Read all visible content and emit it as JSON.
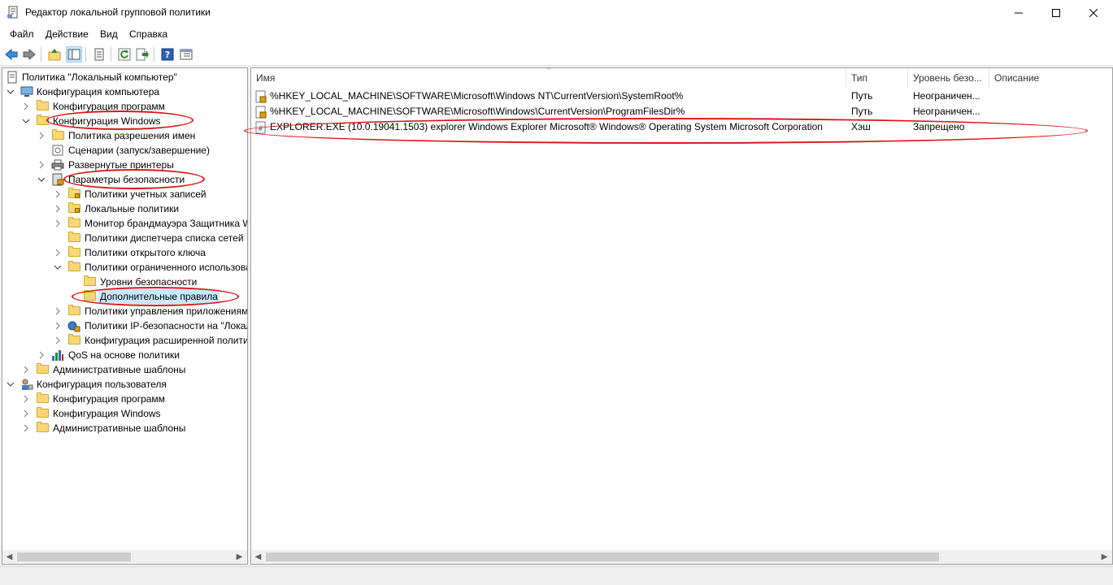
{
  "window": {
    "title": "Редактор локальной групповой политики",
    "icon": "policy-editor-icon",
    "buttons": {
      "minimize": "minimize-icon",
      "maximize": "maximize-icon",
      "close": "close-icon"
    }
  },
  "menu": [
    "Файл",
    "Действие",
    "Вид",
    "Справка"
  ],
  "toolbar": [
    "back-icon",
    "forward-icon",
    "up-folder-icon",
    "show-hide-tree-icon",
    "properties-icon",
    "refresh-icon",
    "export-list-icon",
    "help-icon",
    "extended-view-icon"
  ],
  "tree": [
    {
      "label": "Политика \"Локальный компьютер\"",
      "icon": "policy-icon"
    },
    {
      "label": "Конфигурация компьютера",
      "icon": "computer-icon"
    },
    {
      "label": "Конфигурация программ",
      "icon": "folder-icon"
    },
    {
      "label": "Конфигурация Windows",
      "icon": "folder-icon"
    },
    {
      "label": "Политика разрешения имен",
      "icon": "folder-icon"
    },
    {
      "label": "Сценарии (запуск/завершение)",
      "icon": "script-icon"
    },
    {
      "label": "Развернутые принтеры",
      "icon": "printer-icon"
    },
    {
      "label": "Параметры безопасности",
      "icon": "security-icon"
    },
    {
      "label": "Политики учетных записей",
      "icon": "folder-lock-icon"
    },
    {
      "label": "Локальные политики",
      "icon": "folder-lock-icon"
    },
    {
      "label": "Монитор брандмауэра Защитника Windows",
      "icon": "folder-icon"
    },
    {
      "label": "Политики диспетчера списка сетей",
      "icon": "folder-icon"
    },
    {
      "label": "Политики открытого ключа",
      "icon": "folder-icon"
    },
    {
      "label": "Политики ограниченного использования программ",
      "icon": "folder-icon"
    },
    {
      "label": "Уровни безопасности",
      "icon": "folder-icon"
    },
    {
      "label": "Дополнительные правила",
      "icon": "folder-icon"
    },
    {
      "label": "Политики управления приложениями",
      "icon": "folder-icon"
    },
    {
      "label": "Политики IP-безопасности на \"Локальный компьютер\"",
      "icon": "ip-security-icon"
    },
    {
      "label": "Конфигурация расширенной политики аудита",
      "icon": "folder-icon"
    },
    {
      "label": "QoS на основе политики",
      "icon": "qos-chart-icon"
    },
    {
      "label": "Административные шаблоны",
      "icon": "folder-icon"
    },
    {
      "label": "Конфигурация пользователя",
      "icon": "user-icon"
    },
    {
      "label": "Конфигурация программ",
      "icon": "folder-icon"
    },
    {
      "label": "Конфигурация Windows",
      "icon": "folder-icon"
    },
    {
      "label": "Административные шаблоны",
      "icon": "folder-icon"
    }
  ],
  "list": {
    "columns": [
      "Имя",
      "Тип",
      "Уровень безо...",
      "Описание"
    ],
    "rows": [
      {
        "name": "%HKEY_LOCAL_MACHINE\\SOFTWARE\\Microsoft\\Windows NT\\CurrentVersion\\SystemRoot%",
        "type": "Путь",
        "level": "Неограничен...",
        "desc": "",
        "icon": "path-rule-icon"
      },
      {
        "name": "%HKEY_LOCAL_MACHINE\\SOFTWARE\\Microsoft\\Windows\\CurrentVersion\\ProgramFilesDir%",
        "type": "Путь",
        "level": "Неограничен...",
        "desc": "",
        "icon": "path-rule-icon"
      },
      {
        "name": "EXPLORER.EXE (10.0.19041.1503)  explorer  Windows Explorer  Microsoft® Windows® Operating System  Microsoft Corporation",
        "type": "Хэш",
        "level": "Запрещено",
        "desc": "",
        "icon": "hash-rule-icon"
      }
    ]
  },
  "colors": {
    "selection": "#cce8ff",
    "annotation": "#d81818",
    "folder": "#f8d775"
  }
}
